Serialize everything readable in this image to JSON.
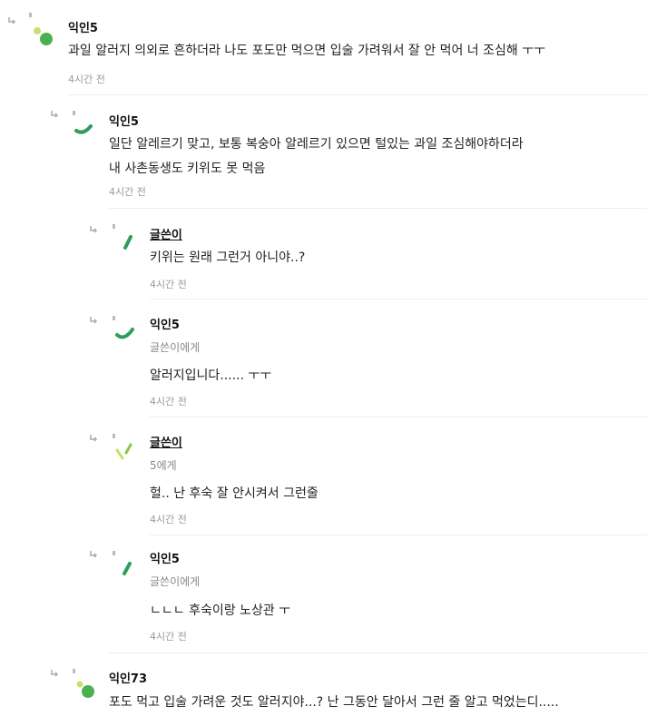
{
  "comments": [
    {
      "author": "익인5",
      "lines": [
        "과일 알러지 의외로 흔하더라 나도 포도만 먹으면 입술 가려워서 잘 안 먹어 너 조심해 ㅜㅜ"
      ],
      "time": "4시간 전",
      "avatar_colors": [
        "#8bc34a",
        "#4caf50"
      ]
    },
    {
      "author": "익인5",
      "lines": [
        "일단 알레르기 맞고, 보통 복숭아 알레르기 있으면 털있는 과일 조심해야하더라",
        "내 사촌동생도 키위도 못 먹음"
      ],
      "time": "4시간 전",
      "avatar_colors": [
        "#2e9e5b"
      ]
    },
    {
      "author": "글쓴이",
      "lines": [
        "키위는 원래 그런거 아니야..?"
      ],
      "time": "4시간 전",
      "avatar_colors": [
        "#2e9e5b"
      ]
    },
    {
      "author": "익인5",
      "mention": "글쓴이에게",
      "lines": [
        "알러지입니다...... ㅜㅜ"
      ],
      "time": "4시간 전",
      "avatar_colors": [
        "#2e9e5b"
      ]
    },
    {
      "author": "글쓴이",
      "mention": "5에게",
      "lines": [
        "헐.. 난 후숙 잘 안시켜서 그런줄"
      ],
      "time": "4시간 전",
      "avatar_colors": [
        "#c8e06b",
        "#8bc34a"
      ]
    },
    {
      "author": "익인5",
      "mention": "글쓴이에게",
      "lines": [
        "ㄴㄴㄴ 후숙이랑 노상관 ㅜ"
      ],
      "time": "4시간 전",
      "avatar_colors": [
        "#2e9e5b"
      ]
    },
    {
      "author": "익인73",
      "lines": [
        "포도 먹고 입술 가려운 것도 알러지야...? 난 그동안 달아서 그런 줄 알고 먹었는디....."
      ],
      "time": "",
      "avatar_colors": [
        "#c8e06b",
        "#4caf50"
      ]
    }
  ],
  "icons": {
    "reply_arrow": "reply-arrow-icon"
  }
}
